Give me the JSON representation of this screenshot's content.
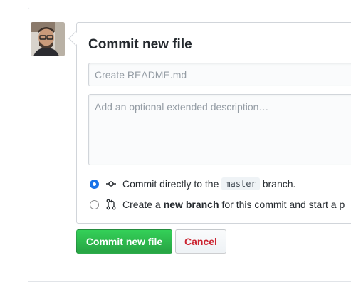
{
  "commit_form": {
    "title": "Commit new file",
    "summary_placeholder": "Create README.md",
    "summary_value": "",
    "description_placeholder": "Add an optional extended description…",
    "description_value": "",
    "option_direct": {
      "selected": true,
      "icon": "git-commit-icon",
      "text_before": "Commit directly to the",
      "branch": "master",
      "text_after": "branch."
    },
    "option_new_branch": {
      "selected": false,
      "icon": "git-pull-request-icon",
      "text_before": "Create a",
      "bold": "new branch",
      "text_after": "for this commit and start a p"
    }
  },
  "actions": {
    "commit_label": "Commit new file",
    "cancel_label": "Cancel"
  },
  "colors": {
    "commit_button": "#2cbe4e",
    "cancel_text": "#cb2431",
    "radio_selected": "#1a73e8"
  }
}
